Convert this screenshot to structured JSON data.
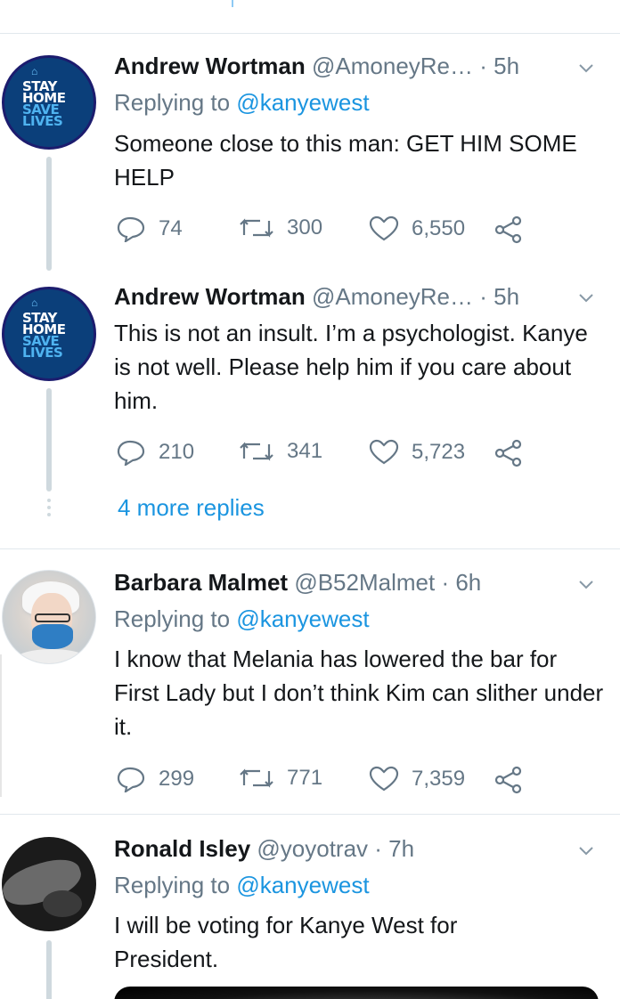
{
  "tweets": [
    {
      "name": "Andrew Wortman",
      "handle": "@AmoneyRe…",
      "time": " · 5h",
      "replying_prefix": "Replying to ",
      "replying_to": "@kanyewest",
      "text": "Someone close to this man: GET HIM SOME HELP",
      "replies": "74",
      "retweets": "300",
      "likes": "6,550",
      "avatar": {
        "line1": "STAY",
        "line2": "HOME",
        "line3": "SAVE",
        "line4": "LIVES"
      }
    },
    {
      "name": "Andrew Wortman",
      "handle": "@AmoneyRe…",
      "time": " · 5h",
      "text": "This is not an insult. I’m a psychologist. Kanye is not well. Please help him if you care about him.",
      "replies": "210",
      "retweets": "341",
      "likes": "5,723",
      "avatar": {
        "line1": "STAY",
        "line2": "HOME",
        "line3": "SAVE",
        "line4": "LIVES"
      },
      "more_replies": "4 more replies"
    },
    {
      "name": "Barbara Malmet",
      "handle": "@B52Malmet",
      "time": " · 6h",
      "replying_prefix": "Replying to ",
      "replying_to": "@kanyewest",
      "text": "I know that Melania has lowered the bar for First Lady but I don’t think Kim can slither under it.",
      "replies": "299",
      "retweets": "771",
      "likes": "7,359"
    },
    {
      "name": "Ronald Isley",
      "handle": "@yoyotrav",
      "time": " · 7h",
      "replying_prefix": "Replying to ",
      "replying_to": "@kanyewest",
      "text": "I will be voting for Kanye West for President."
    }
  ],
  "icons": {
    "reply": "reply-icon",
    "retweet": "retweet-icon",
    "like": "heart-icon",
    "share": "share-icon",
    "menu": "chevron-down-icon"
  },
  "colors": {
    "link": "#1b95e0",
    "secondary": "#657786",
    "text": "#14171a",
    "thread_line": "#cfd9de",
    "stay_home_blue": "#0b3f7a"
  }
}
